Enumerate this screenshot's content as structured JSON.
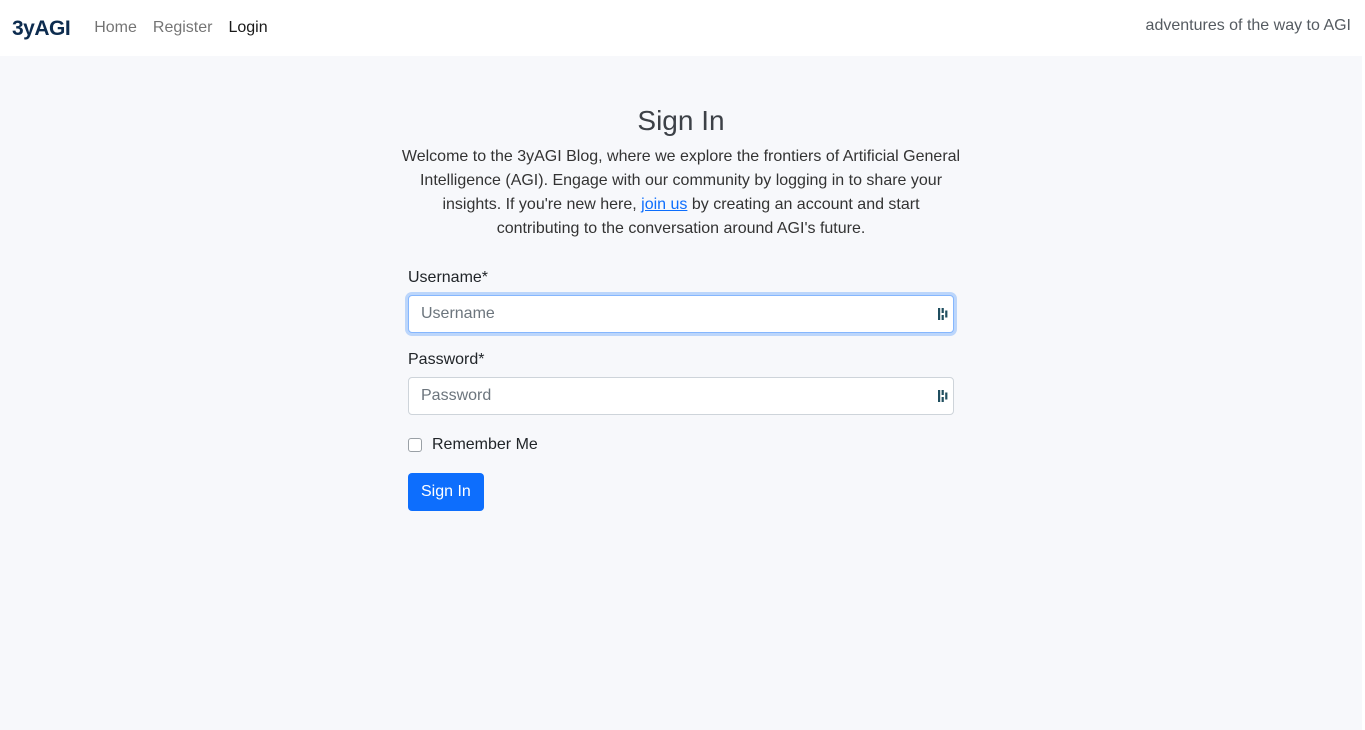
{
  "navbar": {
    "brand": "3yAGI",
    "links": [
      {
        "label": "Home"
      },
      {
        "label": "Register"
      },
      {
        "label": "Login"
      }
    ],
    "tagline": "adventures of the way to AGI"
  },
  "main": {
    "title": "Sign In",
    "intro_before": "Welcome to the 3yAGI Blog, where we explore the frontiers of Artificial General Intelligence (AGI). Engage with our community by logging in to share your insights. If you're new here, ",
    "intro_link": "join us",
    "intro_after": " by creating an account and start contributing to the conversation around AGI's future.",
    "username": {
      "label": "Username*",
      "placeholder": "Username",
      "value": ""
    },
    "password": {
      "label": "Password*",
      "placeholder": "Password",
      "value": ""
    },
    "remember_label": "Remember Me",
    "submit_label": "Sign In"
  },
  "colors": {
    "accent": "#0d6efd",
    "brand": "#0d2c4f",
    "background": "#f7f8fb"
  },
  "icons": {
    "field_icon": "password-manager-key-icon"
  }
}
